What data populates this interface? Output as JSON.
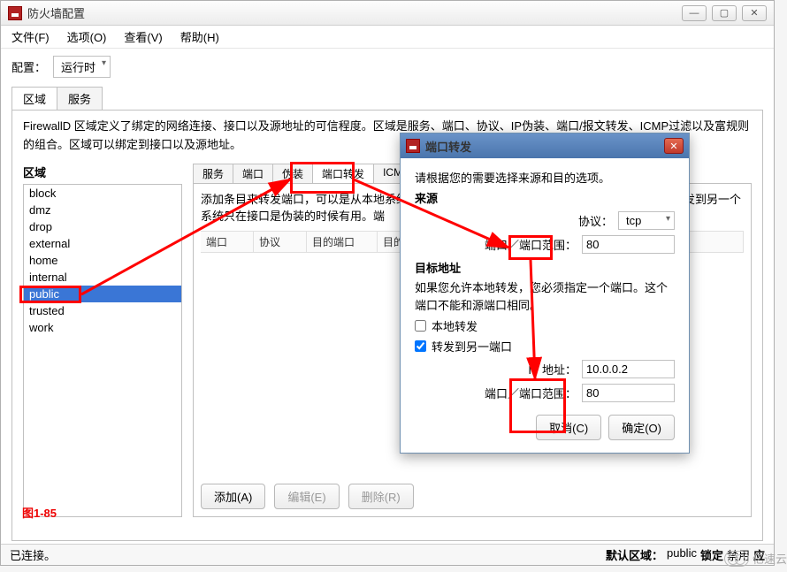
{
  "window": {
    "title": "防火墙配置"
  },
  "menu": {
    "file": "文件(F)",
    "options": "选项(O)",
    "view": "查看(V)",
    "help": "帮助(H)"
  },
  "config": {
    "label": "配置：",
    "value": "运行时"
  },
  "tabs": {
    "zone": "区域",
    "service": "服务"
  },
  "desc": "FirewallD 区域定义了绑定的网络连接、接口以及源地址的可信程度。区域是服务、端口、协议、IP伪装、端口/报文转发、ICMP过滤以及富规则的组合。区域可以绑定到接口以及源地址。",
  "zone": {
    "title": "区域",
    "items": [
      "block",
      "dmz",
      "drop",
      "external",
      "home",
      "internal",
      "public",
      "trusted",
      "work"
    ],
    "selected": "public"
  },
  "subtabs": {
    "services": "服务",
    "ports": "端口",
    "masq": "伪装",
    "portfw": "端口转发",
    "icmp": "ICMP"
  },
  "right": {
    "desc": "添加条目来转发端口，可以是从本地系统到另一个系统，也可以是从一个系统到另一个系统。转发到另一个系统只在接口是伪装的时候有用。端",
    "cols": {
      "port": "端口",
      "proto": "协议",
      "toport": "目的端口",
      "toaddr": "目的地址"
    }
  },
  "buttons": {
    "add": "添加(A)",
    "edit": "编辑(E)",
    "remove": "删除(R)"
  },
  "status": {
    "left": "已连接。",
    "right_label": "默认区域：",
    "zone": "public",
    "lock": "锁定",
    "deny": "禁用",
    "app": "应"
  },
  "figure": "图1-85",
  "dialog": {
    "title": "端口转发",
    "instruct": "请根据您的需要选择来源和目的选项。",
    "source": "来源",
    "proto_label": "协议：",
    "proto_value": "tcp",
    "port_label": "端口／端口范围：",
    "port_value": "80",
    "dest": "目标地址",
    "dest_note": "如果您允许本地转发，您必须指定一个端口。这个端口不能和源端口相同。",
    "local_fw": "本地转发",
    "fw_other": "转发到另一端口",
    "ip_label": "IP 地址：",
    "ip_value": "10.0.0.2",
    "port2_value": "80",
    "cancel": "取消(C)",
    "ok": "确定(O)"
  },
  "watermark": "亿速云"
}
